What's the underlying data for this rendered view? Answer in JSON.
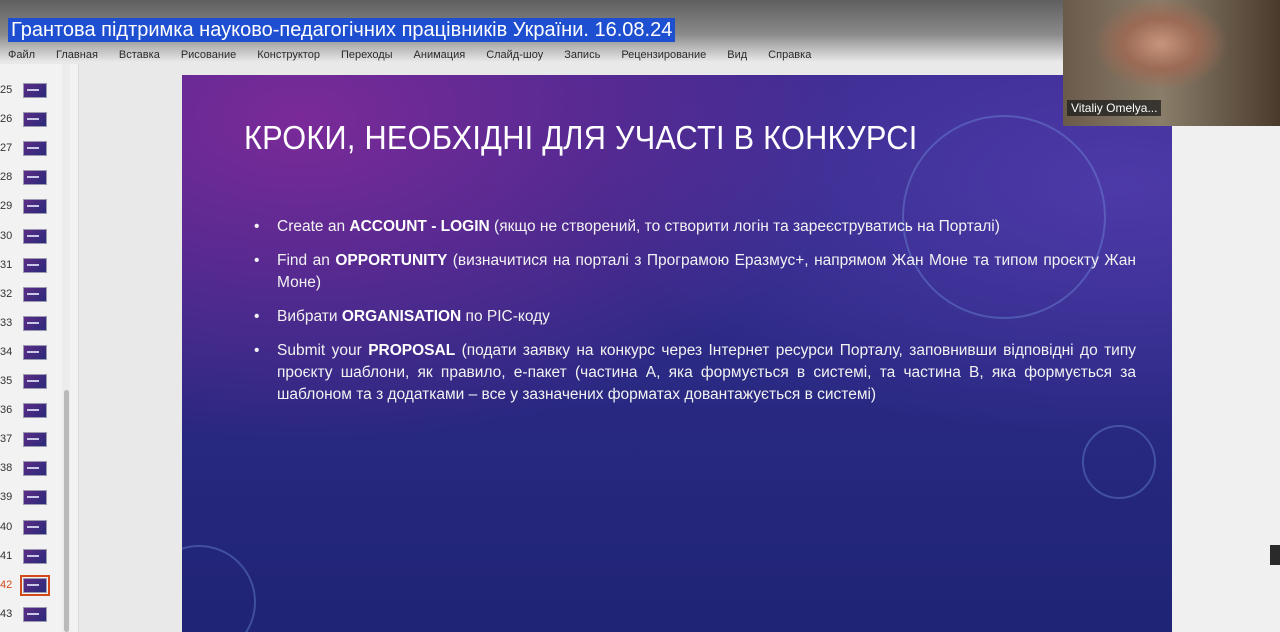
{
  "video": {
    "title": "Грантова підтримка науково-педагогічних працівників України. 16.08.24",
    "controls": [
      {
        "icon": "clock-icon",
        "glyph": "🕓"
      },
      {
        "icon": "share-icon",
        "glyph": "➦"
      }
    ]
  },
  "ribbon": {
    "tabs": [
      "Файл",
      "Главная",
      "Вставка",
      "Рисование",
      "Конструктор",
      "Переходы",
      "Анимация",
      "Слайд-шоу",
      "Запись",
      "Рецензирование",
      "Вид",
      "Справка"
    ]
  },
  "thumbnails": {
    "numbers": [
      "25",
      "26",
      "27",
      "28",
      "29",
      "30",
      "31",
      "32",
      "33",
      "34",
      "35",
      "36",
      "37",
      "38",
      "39",
      "40",
      "41",
      "42",
      "43"
    ],
    "active": "42"
  },
  "slide": {
    "title": "КРОКИ, НЕОБХІДНІ ДЛЯ УЧАСТІ В КОНКУРСІ",
    "bullets": [
      {
        "prefix": "Create an ",
        "bold": "ACCOUNT - LOGIN",
        "rest": " (якщо не створений, то створити логін та зареєструватись на Порталі)"
      },
      {
        "prefix": "Find an ",
        "bold": "OPPORTUNITY",
        "rest": " (визначитися на порталі з Програмою Еразмус+, напрямом Жан Моне та типом проєкту Жан Моне)"
      },
      {
        "prefix": "Вибрати ",
        "bold": "ORGANISATION",
        "rest": " по PIC-коду"
      },
      {
        "prefix": "Submit your ",
        "bold": "PROPOSAL",
        "rest": " (подати заявку на конкурс через Інтернет ресурси Порталу, заповнивши відповідні до типу проєкту шаблони, як правило, е-пакет (частина А, яка формується в системі, та частина В, яка формується за шаблоном та з додатками – все у зазначених форматах довантажується в системі)"
      }
    ]
  },
  "webcam": {
    "participant_name": "Vitaliy Omelya..."
  }
}
